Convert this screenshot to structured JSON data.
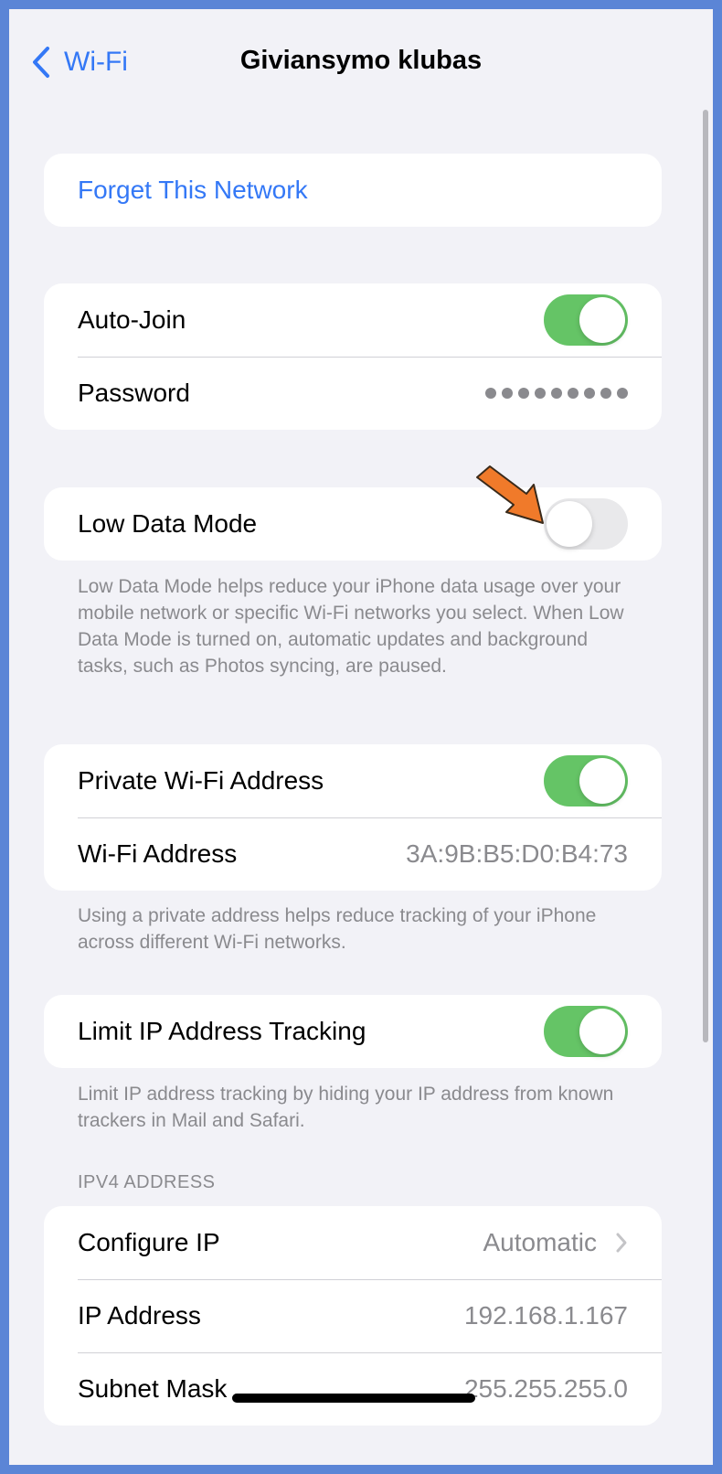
{
  "nav": {
    "back_label": "Wi-Fi",
    "title": "Giviansymo klubas"
  },
  "forget": {
    "label": "Forget This Network"
  },
  "connection": {
    "auto_join_label": "Auto-Join",
    "auto_join_on": true,
    "password_label": "Password"
  },
  "low_data": {
    "label": "Low Data Mode",
    "on": false,
    "footnote": "Low Data Mode helps reduce your iPhone data usage over your mobile network or specific Wi-Fi networks you select. When Low Data Mode is turned on, automatic updates and background tasks, such as Photos syncing, are paused."
  },
  "private_address": {
    "label": "Private Wi-Fi Address",
    "on": true,
    "wifi_address_label": "Wi-Fi Address",
    "wifi_address_value": "3A:9B:B5:D0:B4:73",
    "footnote": "Using a private address helps reduce tracking of your iPhone across different Wi-Fi networks."
  },
  "limit_ip": {
    "label": "Limit IP Address Tracking",
    "on": true,
    "footnote": "Limit IP address tracking by hiding your IP address from known trackers in Mail and Safari."
  },
  "ipv4": {
    "header": "IPV4 ADDRESS",
    "configure_label": "Configure IP",
    "configure_value": "Automatic",
    "ip_label": "IP Address",
    "ip_value": "192.168.1.167",
    "subnet_label": "Subnet Mask",
    "subnet_value": "255.255.255.0"
  },
  "colors": {
    "accent": "#3478f6",
    "toggle_on": "#65c466",
    "arrow": "#f07a2a"
  },
  "icons": {
    "back": "chevron-left-icon",
    "disclosure": "chevron-right-icon",
    "pointer": "orange-arrow-icon"
  }
}
